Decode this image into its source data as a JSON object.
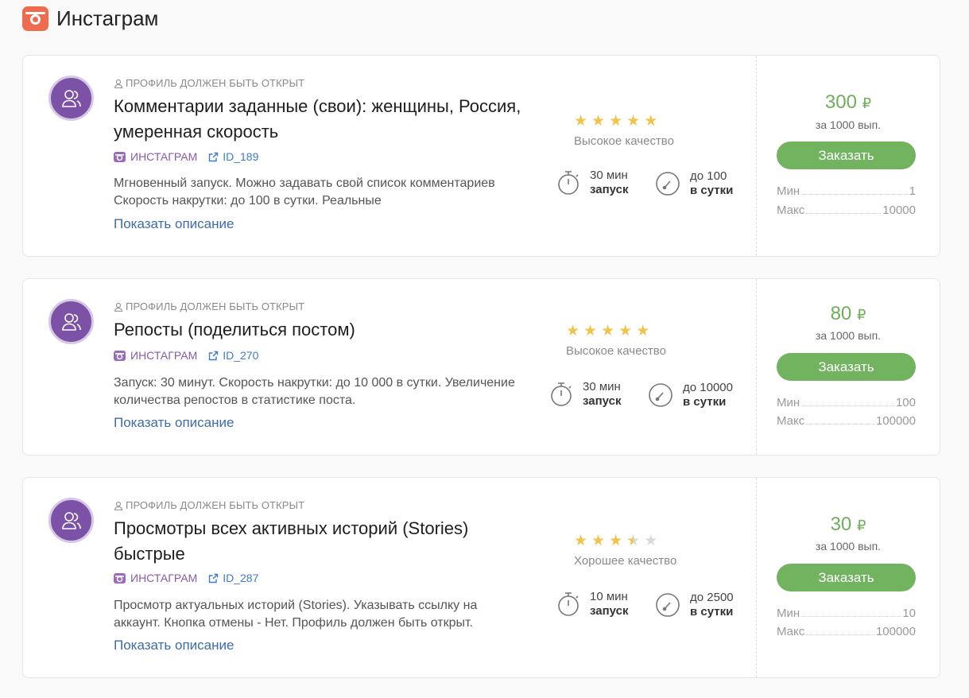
{
  "header": {
    "title": "Инстаграм"
  },
  "cards": [
    {
      "requirement": "ПРОФИЛЬ ДОЛЖЕН БЫТЬ ОТКРЫТ",
      "title": "Комментарии заданные (свои): женщины, Россия, умеренная скорость",
      "platform": "ИНСТАГРАМ",
      "id": "ID_189",
      "description": "Мгновенный запуск. Можно задавать свой список комментариев Скорость накрутки: до 100 в сутки. Реальные",
      "show_more": "Показать описание",
      "rating": 5,
      "quality": "Высокое качество",
      "start_value": "30 мин",
      "start_label": "запуск",
      "speed_value": "до 100",
      "speed_label": "в сутки",
      "price": "300",
      "currency": "₽",
      "per": "за 1000 вып.",
      "order_label": "Заказать",
      "min_label": "Мин",
      "min_value": "1",
      "max_label": "Макс",
      "max_value": "10000"
    },
    {
      "requirement": "ПРОФИЛЬ ДОЛЖЕН БЫТЬ ОТКРЫТ",
      "title": "Репосты (поделиться постом)",
      "platform": "ИНСТАГРАМ",
      "id": "ID_270",
      "description": "Запуск: 30 минут. Скорость накрутки: до 10 000 в сутки. Увеличение количества репостов в статистике поста.",
      "show_more": "Показать описание",
      "rating": 5,
      "quality": "Высокое качество",
      "start_value": "30 мин",
      "start_label": "запуск",
      "speed_value": "до 10000",
      "speed_label": "в сутки",
      "price": "80",
      "currency": "₽",
      "per": "за 1000 вып.",
      "order_label": "Заказать",
      "min_label": "Мин",
      "min_value": "100",
      "max_label": "Макс",
      "max_value": "100000"
    },
    {
      "requirement": "ПРОФИЛЬ ДОЛЖЕН БЫТЬ ОТКРЫТ",
      "title": "Просмотры всех активных историй (Stories) быстрые",
      "platform": "ИНСТАГРАМ",
      "id": "ID_287",
      "description": "Просмотр актуальных историй (Stories). Указывать ссылку на аккаунт. Кнопка отмены - Нет. Профиль должен быть открыт.",
      "show_more": "Показать описание",
      "rating": 3.5,
      "quality": "Хорошее качество",
      "start_value": "10 мин",
      "start_label": "запуск",
      "speed_value": "до 2500",
      "speed_label": "в сутки",
      "price": "30",
      "currency": "₽",
      "per": "за 1000 вып.",
      "order_label": "Заказать",
      "min_label": "Мин",
      "min_value": "10",
      "max_label": "Макс",
      "max_value": "100000"
    }
  ],
  "colors": {
    "accent_green": "#72b360",
    "price_green": "#6fae5b",
    "avatar_purple": "#7b52a6",
    "platform_purple": "#8a5aa8",
    "link_blue": "#3d7ccc",
    "star_gold": "#f0c44c",
    "header_icon": "#ee6b4d"
  },
  "icons": [
    "camera-icon",
    "users-icon",
    "user-icon",
    "external-link-icon",
    "stopwatch-icon",
    "speedometer-icon",
    "star-icon"
  ]
}
